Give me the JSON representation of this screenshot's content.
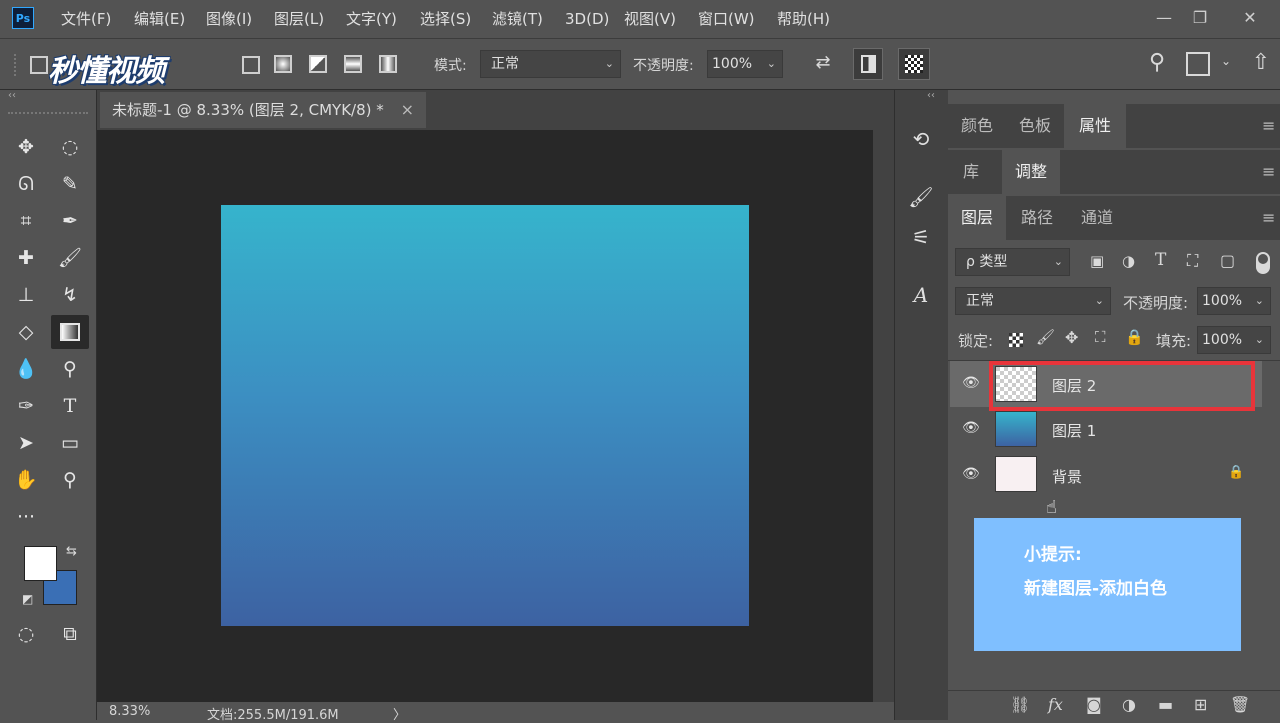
{
  "app": {
    "logo": "Ps"
  },
  "menu": [
    "文件(F)",
    "编辑(E)",
    "图像(I)",
    "图层(L)",
    "文字(Y)",
    "选择(S)",
    "滤镜(T)",
    "3D(D)",
    "视图(V)",
    "窗口(W)",
    "帮助(H)"
  ],
  "window_controls": {
    "minimize": "—",
    "restore": "❐",
    "close": "✕"
  },
  "options": {
    "watermark": "秒懂视频",
    "mode_label": "模式:",
    "mode_value": "正常",
    "opacity_label": "不透明度:",
    "opacity_value": "100%"
  },
  "document": {
    "tab_title": "未标题-1 @ 8.33% (图层 2, CMYK/8) *",
    "close": "×",
    "gradient_colors": [
      "#36b4cc",
      "#3c8fc2",
      "#3d62a2"
    ]
  },
  "status": {
    "zoom": "8.33%",
    "doc_info": "文档:255.5M/191.6M",
    "arrow": "〉"
  },
  "panels": {
    "group1_tabs": [
      "颜色",
      "色板",
      "属性"
    ],
    "group2_tabs": [
      "库",
      "调整"
    ],
    "group3_tabs": [
      "图层",
      "路径",
      "通道"
    ],
    "filter_kind": "ρ 类型",
    "blend_mode": "正常",
    "opacity_label": "不透明度:",
    "opacity_value": "100%",
    "lock_label": "锁定:",
    "fill_label": "填充:",
    "fill_value": "100%"
  },
  "layers": [
    {
      "name": "图层 2",
      "selected": true,
      "highlight_color": "#e8343a"
    },
    {
      "name": "图层 1",
      "selected": false
    },
    {
      "name": "背景",
      "selected": false,
      "locked": true
    }
  ],
  "tip": {
    "title": "小提示:",
    "body": "新建图层-添加白色"
  },
  "colors": {
    "foreground": "#ffffff",
    "background": "#3a6fb5",
    "accent": "#e8343a",
    "tip_bg": "#7fbfff"
  }
}
